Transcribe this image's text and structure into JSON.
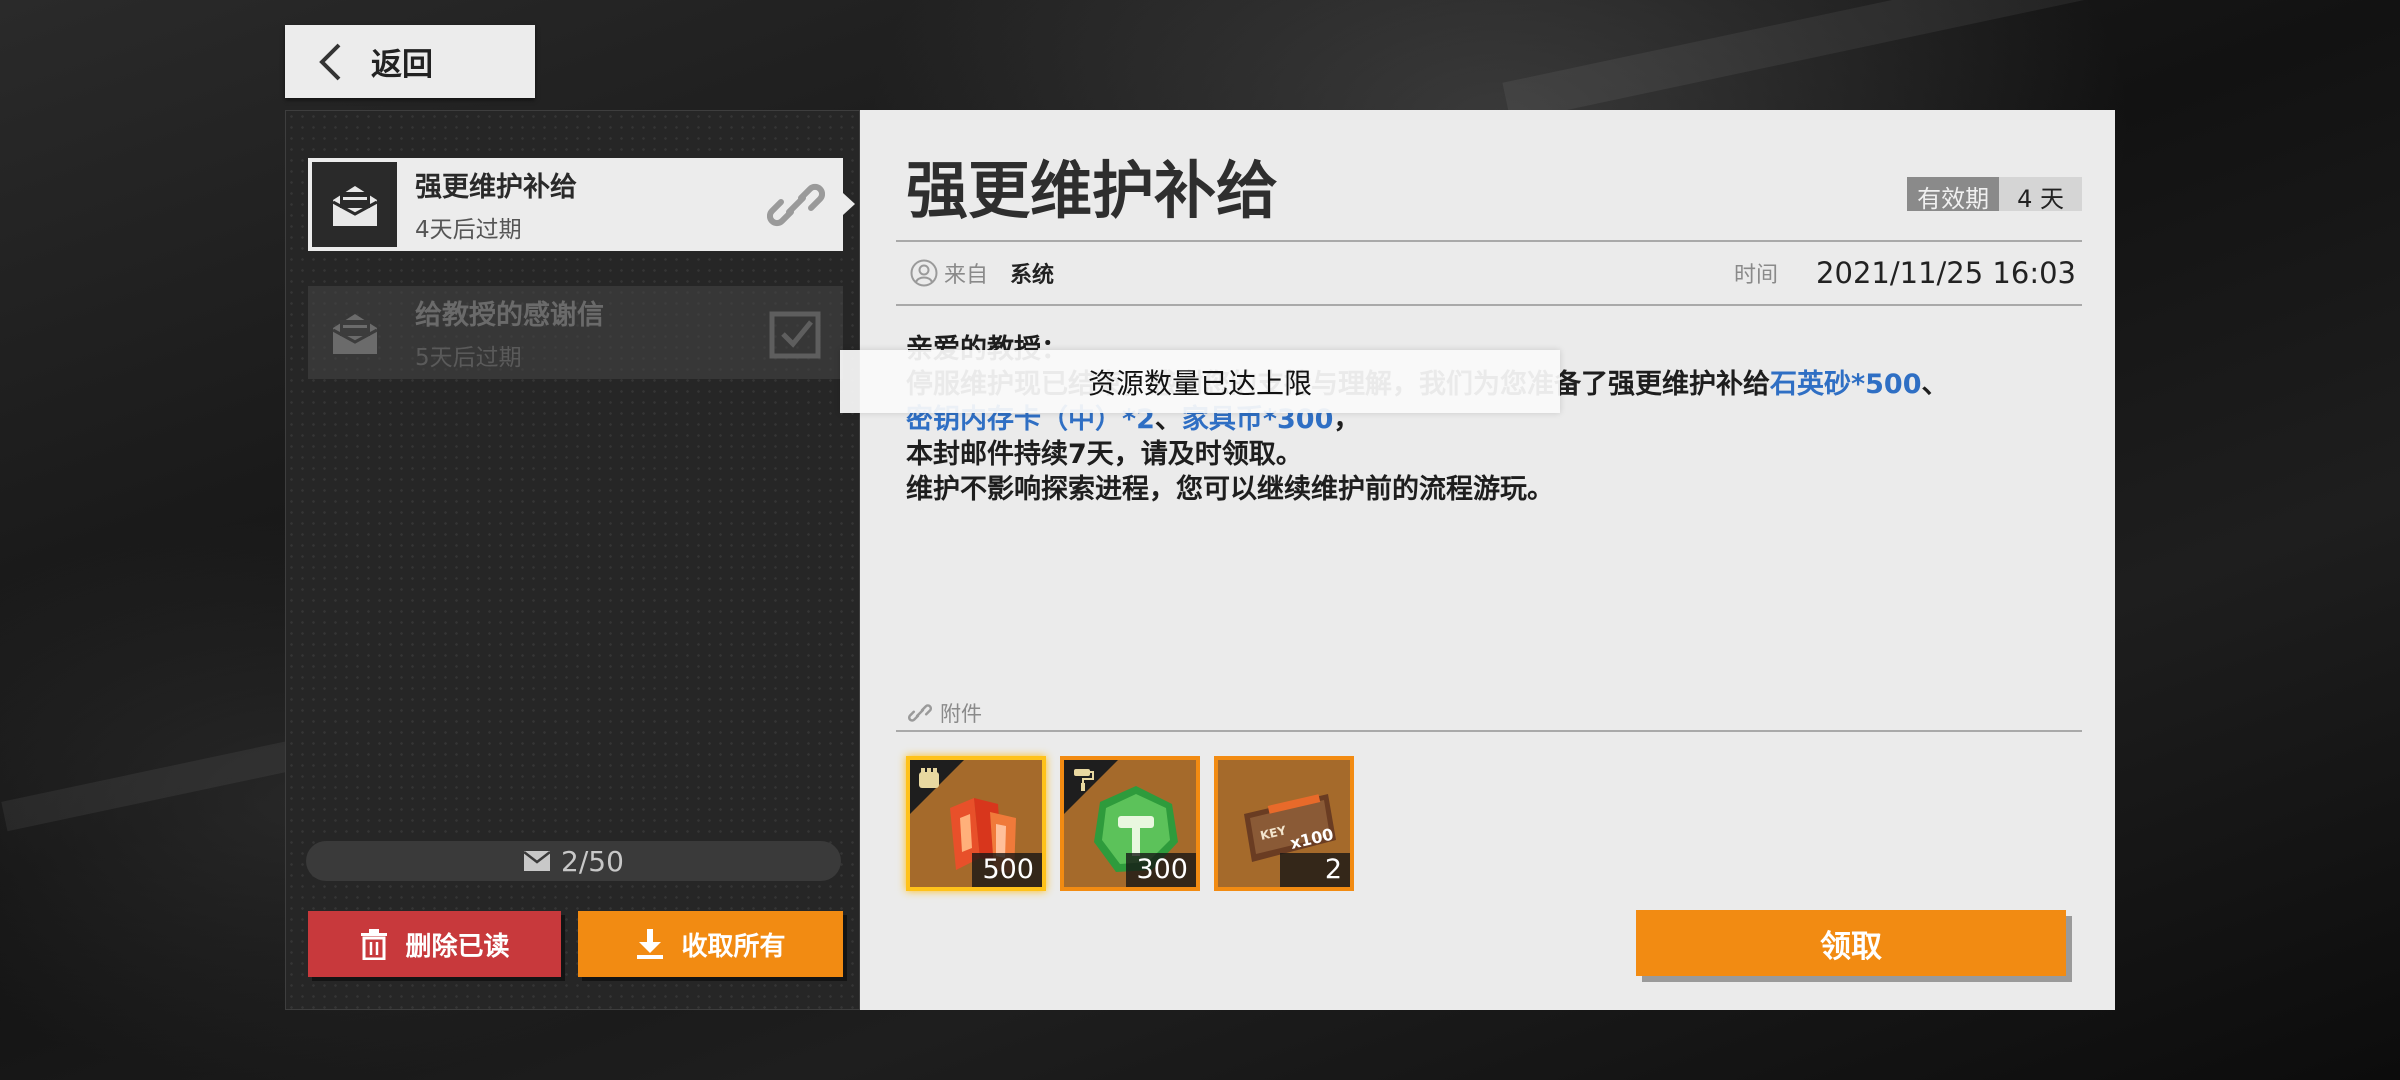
{
  "header": {
    "back_label": "返回"
  },
  "mail_list": {
    "items": [
      {
        "title": "强更维护补给",
        "subtitle": "4天后过期",
        "state": "selected"
      },
      {
        "title": "给教授的感谢信",
        "subtitle": "5天后过期",
        "state": "read"
      }
    ],
    "counter": "2/50",
    "delete_read_label": "删除已读",
    "collect_all_label": "收取所有"
  },
  "mail": {
    "title": "强更维护补给",
    "expiry_label": "有效期",
    "expiry_value": "4 天",
    "from_label": "来自",
    "from_value": "系统",
    "time_label": "时间",
    "time_value": "2021/11/25 16:03",
    "greeting": "亲爱的教授：",
    "line1_text": "停服维护现已结束，感谢您的支持与理解，我们为您准备了强更维护补给",
    "line1_reward": "石英砂*500",
    "line1_sep": "、",
    "line2_reward1": "密钥内存卡（中）*2",
    "line2_sep": "、",
    "line2_reward2": "家具币*300",
    "line2_end": "，",
    "line3": "本封邮件持续7天，请及时领取。",
    "line4": "维护不影响探索进程，您可以继续维护前的流程游玩。",
    "attachments_label": "附件",
    "claim_label": "领取"
  },
  "attachments": [
    {
      "name": "石英砂",
      "count": "500",
      "icon": "quartz-sand-icon",
      "selected": true
    },
    {
      "name": "家具币",
      "count": "300",
      "icon": "furniture-coin-icon",
      "selected": false
    },
    {
      "name": "密钥内存卡（中）",
      "count": "2",
      "icon": "key-memory-card-icon",
      "selected": false
    }
  ],
  "toast": {
    "message": "资源数量已达上限"
  },
  "colors": {
    "accent_orange": "#f28b12",
    "delete_red": "#c8393c",
    "highlight_blue": "#2f6fc4",
    "selected_gold": "#ffc21a"
  }
}
